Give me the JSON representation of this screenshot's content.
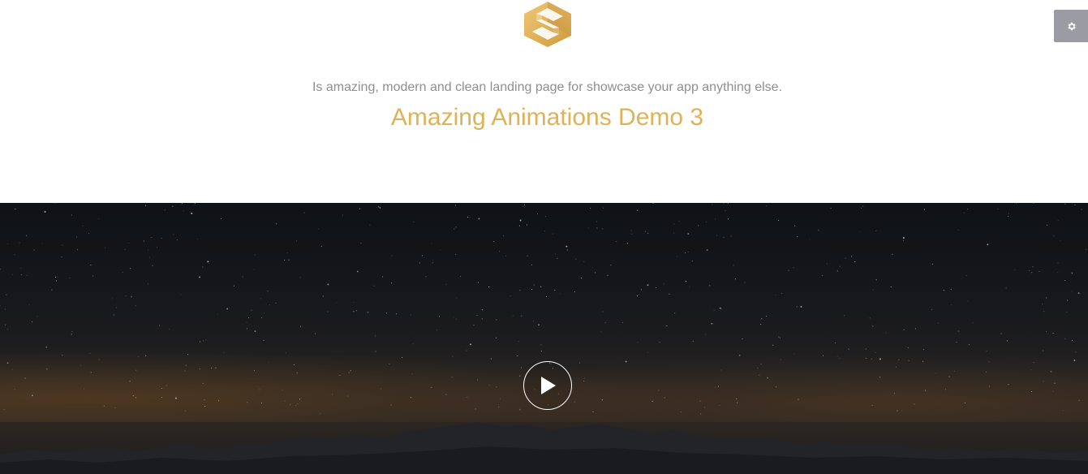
{
  "brand": {
    "logo_icon": "hexagon-s-logo-icon",
    "accent_color": "#dfb257"
  },
  "header": {
    "tagline": "Is amazing, modern and clean landing page for showcase your app anything else.",
    "headline": "Amazing Animations Demo 3"
  },
  "settings": {
    "icon": "gear-icon"
  },
  "hero": {
    "background": "night-sky-over-mountains",
    "play_icon": "play-icon"
  }
}
